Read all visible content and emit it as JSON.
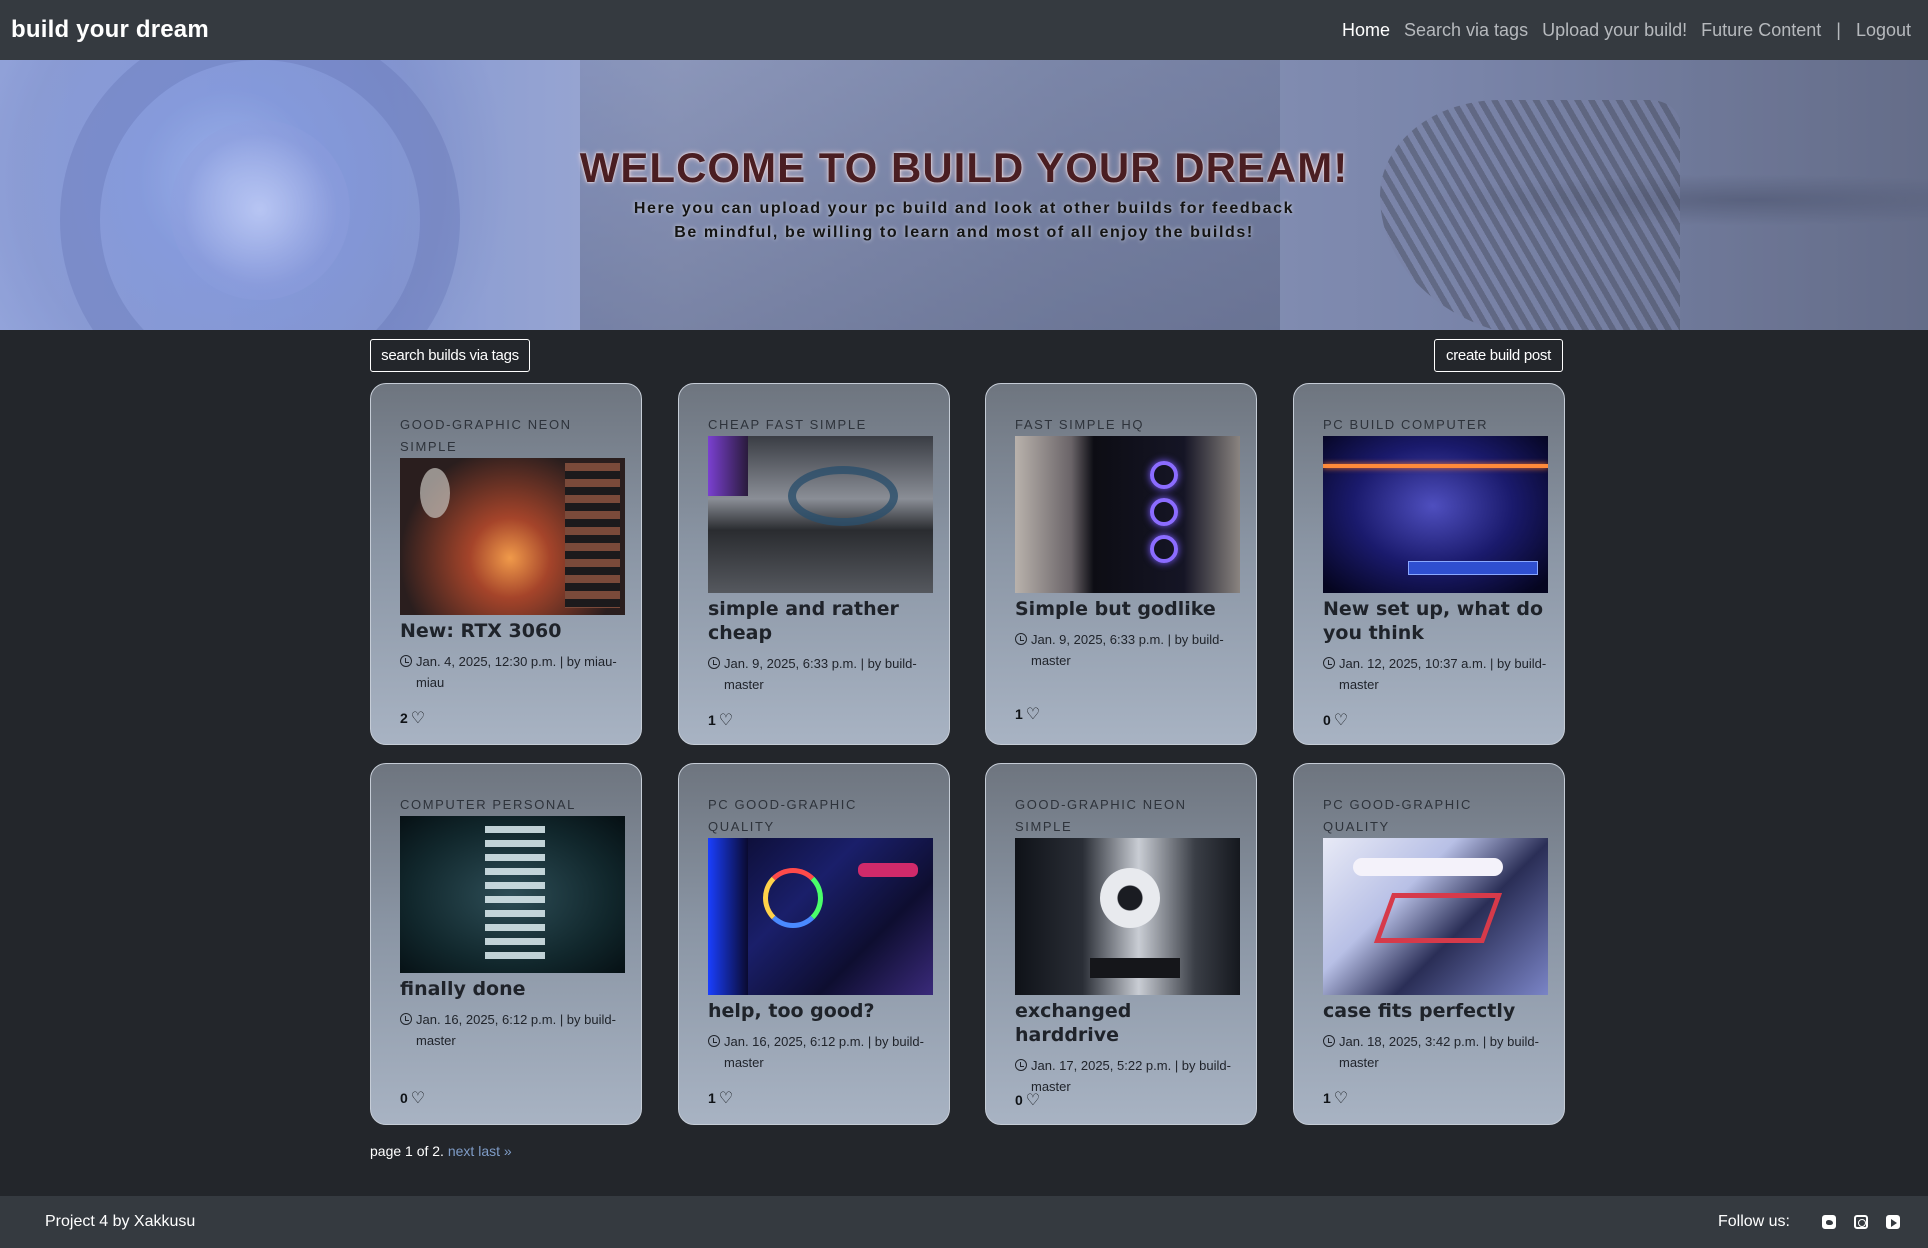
{
  "navbar": {
    "brand": "build your dream",
    "links": [
      "Home",
      "Search via tags",
      "Upload your build!",
      "Future Content"
    ],
    "separator": "|",
    "logout": "Logout"
  },
  "hero": {
    "title": "WELCOME TO BUILD YOUR DREAM!",
    "line1": "Here you can upload your pc build and look at other builds for feedback",
    "line2": "Be mindful, be willing to learn and most of all enjoy the builds!"
  },
  "toolbar": {
    "search_button": "search builds via tags",
    "create_button": "create build post"
  },
  "cards": [
    {
      "tags": "GOOD-GRAPHIC NEON SIMPLE",
      "title": "New: RTX 3060",
      "meta": "Jan. 4, 2025, 12:30 p.m. | by miau-miau",
      "likes": "2"
    },
    {
      "tags": "CHEAP FAST SIMPLE",
      "title": "simple and rather cheap",
      "meta": "Jan. 9, 2025, 6:33 p.m. | by build-master",
      "likes": "1"
    },
    {
      "tags": "FAST SIMPLE HQ",
      "title": "Simple but godlike",
      "meta": "Jan. 9, 2025, 6:33 p.m. | by build-master",
      "likes": "1"
    },
    {
      "tags": "PC BUILD COMPUTER",
      "title": "New set up, what do you think",
      "meta": "Jan. 12, 2025, 10:37 a.m. | by build-master",
      "likes": "0"
    },
    {
      "tags": "COMPUTER PERSONAL",
      "title": "finally done",
      "meta": "Jan. 16, 2025, 6:12 p.m. | by build-master",
      "likes": "0"
    },
    {
      "tags": "PC GOOD-GRAPHIC QUALITY",
      "title": "help, too good?",
      "meta": "Jan. 16, 2025, 6:12 p.m. | by build-master",
      "likes": "1"
    },
    {
      "tags": "GOOD-GRAPHIC NEON SIMPLE",
      "title": "exchanged harddrive",
      "meta": "Jan. 17, 2025, 5:22 p.m. | by build-master",
      "likes": "0"
    },
    {
      "tags": "PC GOOD-GRAPHIC QUALITY",
      "title": "case fits perfectly",
      "meta": "Jan. 18, 2025, 3:42 p.m. | by build-master",
      "likes": "1"
    }
  ],
  "pagination": {
    "text": "page 1 of 2.",
    "next": "next",
    "last": "last »"
  },
  "footer": {
    "credit": "Project 4 by Xakkusu",
    "follow": "Follow us:",
    "icons": [
      "twitter-icon",
      "instagram-icon",
      "youtube-icon"
    ]
  }
}
